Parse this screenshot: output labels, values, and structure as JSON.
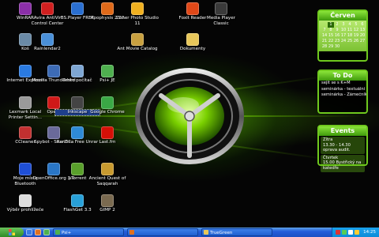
{
  "desktop_icons": [
    {
      "label": "WinRAR",
      "icon": "winrar-icon",
      "color": "#8b2fa8"
    },
    {
      "label": "Avira AntiVir Control Center",
      "icon": "avira-umbrella-icon",
      "color": "#d12020"
    },
    {
      "label": "BS.Player FREE",
      "icon": "bsplayer-icon",
      "color": "#2a6fd1"
    },
    {
      "label": "Apophysis 2.02",
      "icon": "apophysis-icon",
      "color": "#e06a1a"
    },
    {
      "label": "Zoner Photo Studio 11",
      "icon": "zoner-icon",
      "color": "#f0b020"
    },
    {
      "label": "Foxit Reader",
      "icon": "foxit-icon",
      "color": "#e04818"
    },
    {
      "label": "Media Player Classic",
      "icon": "mpc-icon",
      "color": "#3a3a3a"
    },
    {
      "label": "Koš",
      "icon": "recycle-bin-icon",
      "color": "#6a8aa6"
    },
    {
      "label": "Rainlendar2",
      "icon": "rainlendar-icon",
      "color": "#4a90d9"
    },
    {
      "label": "Ant Movie Catalog",
      "icon": "ant-movie-icon",
      "color": "#c8a040"
    },
    {
      "label": "Dokumenty",
      "icon": "documents-folder-icon",
      "color": "#e8c75a"
    },
    {
      "label": "Internet Explorer",
      "icon": "internet-explorer-icon",
      "color": "#2a7ae0"
    },
    {
      "label": "Mozilla Thunderbird",
      "icon": "thunderbird-icon",
      "color": "#3d6bb5"
    },
    {
      "label": "Tento počítač",
      "icon": "my-computer-icon",
      "color": "#7ea6d3"
    },
    {
      "label": "Psi+ JE",
      "icon": "psi-icon",
      "color": "#4fb04f"
    },
    {
      "label": "Lexmark Local Printer Settin...",
      "icon": "lexmark-printer-icon",
      "color": "#9a9a9a"
    },
    {
      "label": "Opera",
      "icon": "opera-icon",
      "color": "#d01818"
    },
    {
      "label": "Inkscape",
      "icon": "inkscape-icon",
      "color": "#444444"
    },
    {
      "label": "Google Chrome",
      "icon": "chrome-icon",
      "color": "#3aa845"
    },
    {
      "label": "CCleaner",
      "icon": "ccleaner-icon",
      "color": "#c23030"
    },
    {
      "label": "Spybot - Search...",
      "icon": "spybot-icon",
      "color": "#6a6a9a"
    },
    {
      "label": "RarZilla Free Unrar",
      "icon": "rarzilla-icon",
      "color": "#2e8ad6"
    },
    {
      "label": "Last.fm",
      "icon": "lastfm-icon",
      "color": "#d51007"
    },
    {
      "label": "Moje místa Bluetooth",
      "icon": "bluetooth-icon",
      "color": "#1f4fd6"
    },
    {
      "label": "OpenOffice.org 3.0",
      "icon": "openoffice-icon",
      "color": "#2a76c6"
    },
    {
      "label": "µTorrent",
      "icon": "utorrent-icon",
      "color": "#5aa02c"
    },
    {
      "label": "Ancient Quest of Saqqarah",
      "icon": "saqqarah-icon",
      "color": "#c89a30"
    },
    {
      "label": "Výběr prohlížeče",
      "icon": "browser-choice-icon",
      "color": "#dcdcdc"
    },
    {
      "label": "FlashGet 3.3",
      "icon": "flashget-icon",
      "color": "#28a0d8"
    },
    {
      "label": "GIMP 2",
      "icon": "gimp-icon",
      "color": "#7a6a50"
    }
  ],
  "calendar": {
    "title": "Červen",
    "days": [
      "",
      "1",
      "2",
      "3",
      "4",
      "5",
      "6",
      "7",
      "8",
      "9",
      "10",
      "11",
      "12",
      "13",
      "14",
      "15",
      "16",
      "17",
      "18",
      "19",
      "20",
      "21",
      "22",
      "23",
      "24",
      "25",
      "26",
      "27",
      "28",
      "29",
      "30",
      "",
      "",
      "",
      ""
    ],
    "today": "1"
  },
  "todo": {
    "title": "To Do",
    "items": [
      "sejít se s K+M",
      "seminárka - textuální ana",
      "seminárka - Zámečník"
    ]
  },
  "events": {
    "title": "Events",
    "items": [
      {
        "day": "Zítra",
        "text": "13.30 - 14.30 oprava audit."
      },
      {
        "day": "Čtvrtek",
        "text": "15.00 Bystřický na katedře"
      }
    ]
  },
  "taskbar": {
    "tasks": [
      {
        "label": "Psi+",
        "icon": "psi-icon",
        "color": "#4fb04f"
      },
      {
        "label": "",
        "icon": "firefox-icon",
        "color": "#e07020"
      },
      {
        "label": "TrueGreen",
        "icon": "folder-icon",
        "color": "#e8c75a"
      }
    ],
    "clock": "14:25"
  },
  "colors": {
    "accent": "#6fc81e",
    "taskbar": "#245edb"
  }
}
